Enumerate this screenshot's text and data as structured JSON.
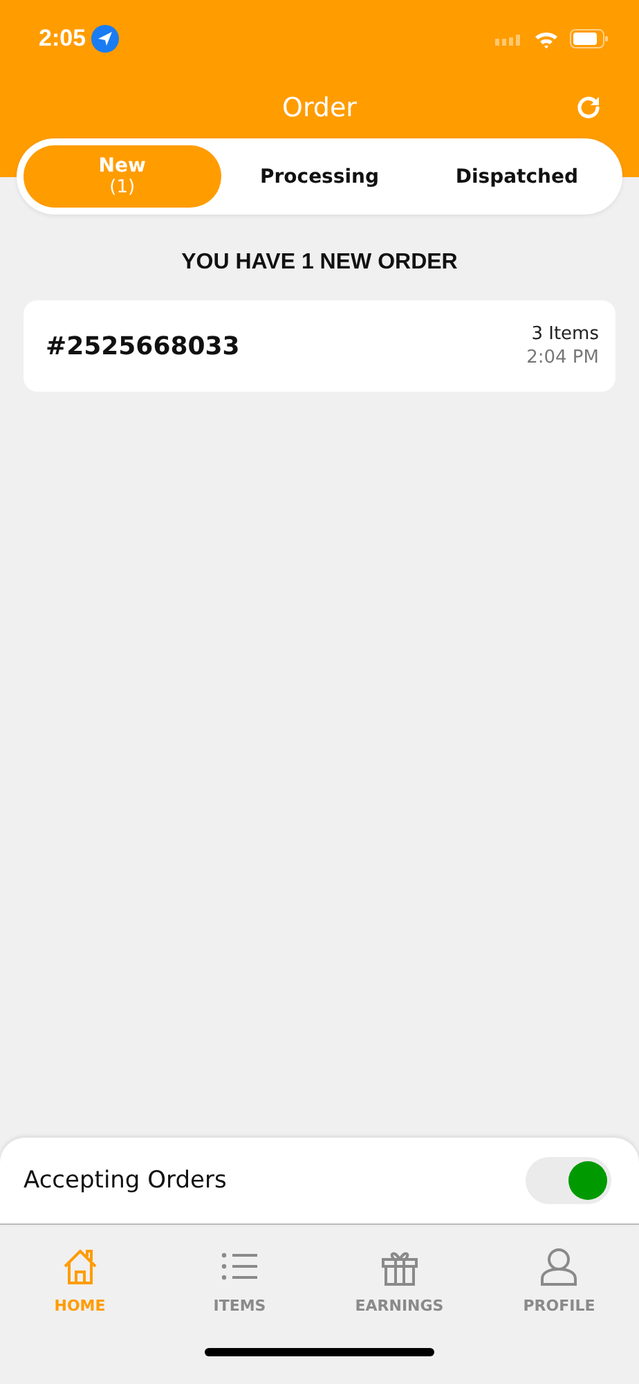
{
  "status_bar": {
    "time": "2:05"
  },
  "header": {
    "title": "Order"
  },
  "tabs": [
    {
      "label": "New",
      "count": "(1)",
      "selected": true
    },
    {
      "label": "Processing",
      "selected": false
    },
    {
      "label": "Dispatched",
      "selected": false
    }
  ],
  "heading": "YOU HAVE 1 NEW ORDER",
  "orders": [
    {
      "number": "#2525668033",
      "items": "3 Items",
      "time": "2:04 PM"
    }
  ],
  "accepting": {
    "label": "Accepting Orders",
    "on": true
  },
  "nav": [
    {
      "label": "HOME",
      "selected": true
    },
    {
      "label": "ITEMS",
      "selected": false
    },
    {
      "label": "EARNINGS",
      "selected": false
    },
    {
      "label": "PROFILE",
      "selected": false
    }
  ]
}
